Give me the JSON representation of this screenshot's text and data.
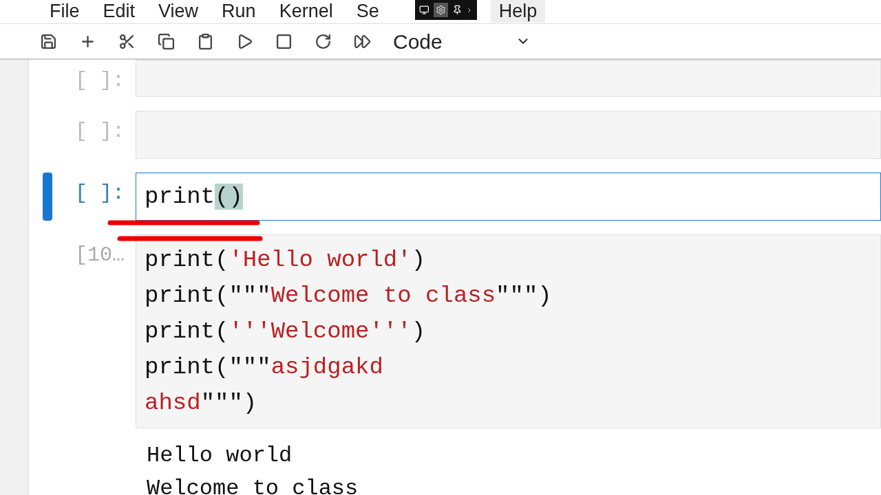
{
  "menu": [
    {
      "label": "File",
      "selected": false
    },
    {
      "label": "Edit",
      "selected": false
    },
    {
      "label": "View",
      "selected": false
    },
    {
      "label": "Run",
      "selected": false
    },
    {
      "label": "Kernel",
      "selected": false
    },
    {
      "label": "Se",
      "selected": false
    },
    {
      "label": "Help",
      "selected": true
    }
  ],
  "toolbar": {
    "cell_type": "Code"
  },
  "cells": [
    {
      "prompt": "[ ]:",
      "active": false
    },
    {
      "prompt": "[ ]:",
      "active": false
    },
    {
      "prompt": "[ ]:",
      "active": true,
      "lines": [
        [
          {
            "kind": "plain",
            "text": "print"
          },
          {
            "kind": "matched",
            "text": "()"
          }
        ]
      ]
    },
    {
      "prompt": "[10…",
      "active": false,
      "lines": [
        [
          {
            "kind": "plain",
            "text": "print("
          },
          {
            "kind": "string",
            "text": "'Hello world'"
          },
          {
            "kind": "plain",
            "text": ")"
          }
        ],
        [
          {
            "kind": "plain",
            "text": "print("
          },
          {
            "kind": "plain",
            "text": "\"\"\""
          },
          {
            "kind": "string",
            "text": "Welcome to class"
          },
          {
            "kind": "plain",
            "text": "\"\"\")"
          }
        ],
        [
          {
            "kind": "plain",
            "text": "print("
          },
          {
            "kind": "string",
            "text": "'''Welcome'''"
          },
          {
            "kind": "plain",
            "text": ")"
          }
        ],
        [
          {
            "kind": "plain",
            "text": "print("
          },
          {
            "kind": "plain",
            "text": "\"\"\""
          },
          {
            "kind": "string",
            "text": "asjdgakd"
          }
        ],
        [
          {
            "kind": "string",
            "text": "ahsd"
          },
          {
            "kind": "plain",
            "text": "\"\"\")"
          }
        ]
      ],
      "output": [
        "Hello world",
        "Welcome to class"
      ]
    }
  ]
}
